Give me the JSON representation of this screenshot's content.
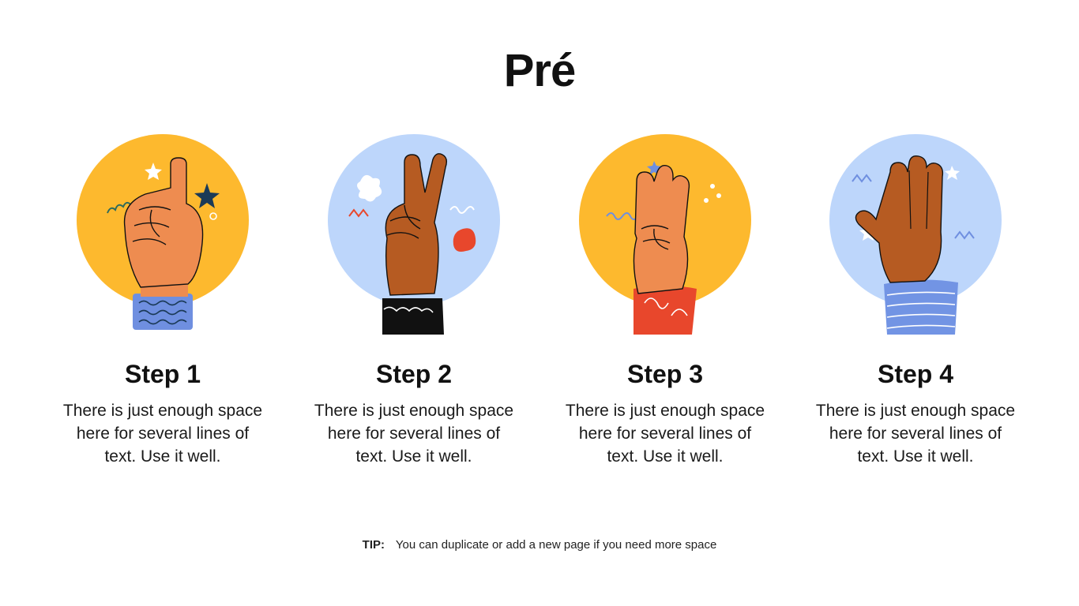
{
  "page": {
    "title": "Pré"
  },
  "steps": [
    {
      "title": "Step 1",
      "description": "There is just enough space here for several lines of text. Use it well.",
      "circle_color": "#FDB92E",
      "skin_color": "#EE8C50",
      "sleeve_color": "#6F8FE0",
      "icon": "index-finger-up-hand-icon"
    },
    {
      "title": "Step 2",
      "description": "There is just enough space here for several lines of text. Use it well.",
      "circle_color": "#BDD6FB",
      "skin_color": "#B65B22",
      "sleeve_color": "#111111",
      "icon": "peace-sign-hand-icon"
    },
    {
      "title": "Step 3",
      "description": "There is just enough space here for several lines of text. Use it well.",
      "circle_color": "#FDB92E",
      "skin_color": "#EE8C50",
      "sleeve_color": "#E8472C",
      "icon": "three-fingers-hand-icon"
    },
    {
      "title": "Step 4",
      "description": "There is just enough space here for several lines of text. Use it well.",
      "circle_color": "#BDD6FB",
      "skin_color": "#B65B22",
      "sleeve_color": "#7294E4",
      "icon": "four-fingers-hand-icon"
    }
  ],
  "tip": {
    "label": "TIP:",
    "text": "You can duplicate or add a new page if you need more space"
  }
}
